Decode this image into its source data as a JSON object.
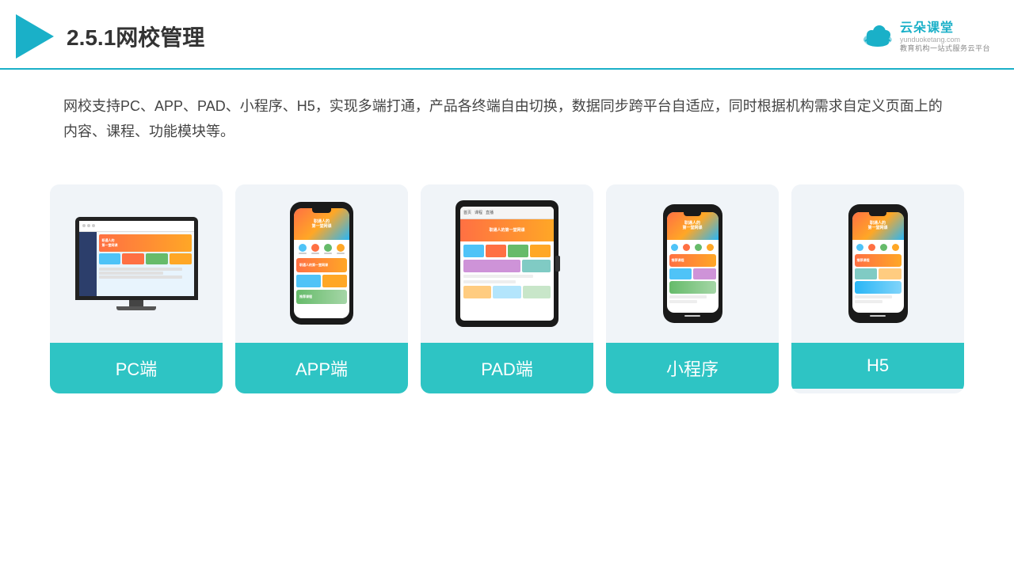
{
  "header": {
    "title": "2.5.1网校管理",
    "brand_name": "云朵课堂",
    "brand_url": "yunduoketang.com",
    "brand_tagline": "教育机构一站",
    "brand_tagline2": "式服务云平台"
  },
  "description": {
    "text": "网校支持PC、APP、PAD、小程序、H5，实现多端打通，产品各终端自由切换，数据同步跨平台自适应，同时根据机构需求自定义页面上的内容、课程、功能模块等。"
  },
  "cards": [
    {
      "id": "pc",
      "label": "PC端"
    },
    {
      "id": "app",
      "label": "APP端"
    },
    {
      "id": "pad",
      "label": "PAD端"
    },
    {
      "id": "miniprogram",
      "label": "小程序"
    },
    {
      "id": "h5",
      "label": "H5"
    }
  ],
  "colors": {
    "accent": "#2ec4c4",
    "header_line": "#1ab0c8",
    "triangle": "#1ab0c8"
  }
}
